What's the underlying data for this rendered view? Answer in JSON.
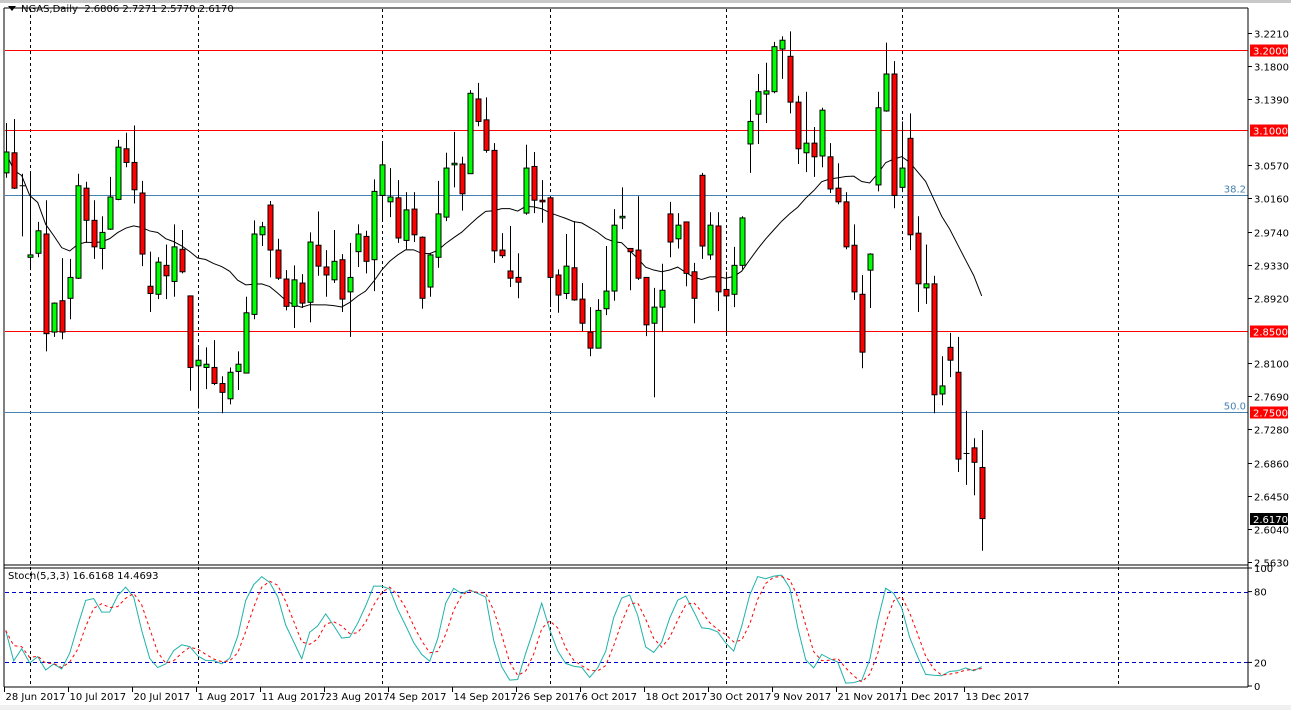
{
  "header": {
    "symbol": "NGAS,Daily",
    "ohlc": "2.6806 2.7271 2.5770 2.6170"
  },
  "stoch_label": "Stoch(5,3,3) 16.6168 14.4693",
  "colors": {
    "bull": "#00ff00",
    "bear": "#ff0000",
    "level": "#ff0000",
    "fib": "#4682b4",
    "k_line": "#20b2aa",
    "d_line": "#ff0000",
    "stoch_levels": "#0000cd"
  },
  "chart_data": {
    "type": "candlestick",
    "title": "NGAS,Daily",
    "ylim": [
      2.563,
      3.221
    ],
    "price_ticks": [
      "3.2210",
      "3.1800",
      "3.1390",
      "3.0570",
      "3.0160",
      "2.9740",
      "2.9330",
      "2.8920",
      "2.8100",
      "2.7690",
      "2.7280",
      "2.6860",
      "2.6450",
      "2.6040",
      "2.5630"
    ],
    "date_labels": [
      {
        "bar": 0,
        "label": "28 Jun 2017"
      },
      {
        "bar": 8,
        "label": "10 Jul 2017"
      },
      {
        "bar": 16,
        "label": "20 Jul 2017"
      },
      {
        "bar": 24,
        "label": "1 Aug 2017"
      },
      {
        "bar": 32,
        "label": "11 Aug 2017"
      },
      {
        "bar": 40,
        "label": "23 Aug 2017"
      },
      {
        "bar": 48,
        "label": "4 Sep 2017"
      },
      {
        "bar": 56,
        "label": "14 Sep 2017"
      },
      {
        "bar": 64,
        "label": "26 Sep 2017"
      },
      {
        "bar": 72,
        "label": "6 Oct 2017"
      },
      {
        "bar": 80,
        "label": "18 Oct 2017"
      },
      {
        "bar": 88,
        "label": "30 Oct 2017"
      },
      {
        "bar": 96,
        "label": "9 Nov 2017"
      },
      {
        "bar": 104,
        "label": "21 Nov 2017"
      },
      {
        "bar": 112,
        "label": "1 Dec 2017"
      },
      {
        "bar": 120,
        "label": "13 Dec 2017"
      }
    ],
    "period_separators": [
      3,
      24,
      47,
      68,
      90,
      112,
      139
    ],
    "horizontal_levels": [
      {
        "price": 3.2,
        "label": "3.2000"
      },
      {
        "price": 3.1,
        "label": "3.1000"
      },
      {
        "price": 2.85,
        "label": "2.8500"
      }
    ],
    "fib_levels": [
      {
        "price": 3.02,
        "ratio": "38.2"
      },
      {
        "price": 2.75,
        "ratio": "50.0",
        "label": "2.7500"
      }
    ],
    "last_price": {
      "price": 2.617,
      "label": "2.6170"
    },
    "moving_average": {
      "type": "SMA",
      "period": 20
    },
    "stochastic": {
      "k": 5,
      "d": 3,
      "slowing": 3,
      "levels": [
        80,
        20
      ],
      "ticks": [
        "100",
        "80",
        "20",
        "0"
      ]
    },
    "ohlc": [
      [
        3.047,
        3.109,
        3.041,
        3.073
      ],
      [
        3.072,
        3.114,
        3.027,
        3.028
      ],
      [
        3.031,
        3.046,
        2.968,
        3.03
      ],
      [
        2.942,
        3.048,
        2.926,
        2.945
      ],
      [
        2.947,
        2.986,
        2.942,
        2.975
      ],
      [
        2.971,
        3.013,
        2.825,
        2.847
      ],
      [
        2.849,
        2.886,
        2.843,
        2.885
      ],
      [
        2.888,
        2.941,
        2.84,
        2.849
      ],
      [
        2.891,
        2.94,
        2.865,
        2.917
      ],
      [
        2.916,
        3.046,
        2.915,
        3.031
      ],
      [
        3.028,
        3.036,
        2.96,
        2.988
      ],
      [
        2.988,
        3.013,
        2.94,
        2.955
      ],
      [
        2.953,
        2.993,
        2.927,
        2.973
      ],
      [
        2.977,
        3.042,
        2.976,
        3.017
      ],
      [
        3.014,
        3.088,
        3.013,
        3.079
      ],
      [
        3.077,
        3.097,
        3.054,
        3.06
      ],
      [
        3.06,
        3.106,
        3.009,
        3.026
      ],
      [
        3.022,
        3.037,
        2.931,
        2.946
      ],
      [
        2.906,
        2.949,
        2.874,
        2.897
      ],
      [
        2.896,
        2.942,
        2.89,
        2.936
      ],
      [
        2.932,
        2.958,
        2.89,
        2.919
      ],
      [
        2.912,
        2.983,
        2.893,
        2.955
      ],
      [
        2.952,
        2.976,
        2.922,
        2.924
      ],
      [
        2.894,
        2.894,
        2.776,
        2.805
      ],
      [
        2.807,
        2.832,
        2.754,
        2.814
      ],
      [
        2.805,
        2.83,
        2.778,
        2.809
      ],
      [
        2.805,
        2.839,
        2.783,
        2.785
      ],
      [
        2.785,
        2.794,
        2.748,
        2.774
      ],
      [
        2.766,
        2.805,
        2.759,
        2.799
      ],
      [
        2.8,
        2.825,
        2.777,
        2.809
      ],
      [
        2.798,
        2.893,
        2.798,
        2.873
      ],
      [
        2.871,
        2.988,
        2.865,
        2.971
      ],
      [
        2.97,
        2.986,
        2.956,
        2.98
      ],
      [
        3.007,
        3.012,
        2.917,
        2.951
      ],
      [
        2.951,
        2.965,
        2.914,
        2.916
      ],
      [
        2.915,
        2.926,
        2.876,
        2.881
      ],
      [
        2.881,
        2.932,
        2.854,
        2.914
      ],
      [
        2.91,
        2.921,
        2.879,
        2.885
      ],
      [
        2.886,
        2.973,
        2.861,
        2.961
      ],
      [
        2.957,
        2.999,
        2.919,
        2.931
      ],
      [
        2.93,
        2.951,
        2.893,
        2.92
      ],
      [
        2.914,
        2.976,
        2.91,
        2.937
      ],
      [
        2.939,
        2.946,
        2.874,
        2.89
      ],
      [
        2.899,
        2.96,
        2.843,
        2.917
      ],
      [
        2.949,
        2.983,
        2.93,
        2.971
      ],
      [
        2.968,
        2.975,
        2.922,
        2.937
      ],
      [
        2.939,
        3.039,
        2.9,
        3.024
      ],
      [
        3.019,
        3.085,
        2.988,
        3.057
      ],
      [
        3.011,
        3.053,
        2.992,
        3.017
      ],
      [
        3.016,
        3.038,
        2.96,
        2.966
      ],
      [
        2.963,
        3.023,
        2.952,
        3.001
      ],
      [
        3.002,
        3.023,
        2.961,
        2.97
      ],
      [
        2.967,
        2.968,
        2.878,
        2.891
      ],
      [
        2.905,
        2.947,
        2.893,
        2.945
      ],
      [
        2.942,
        3.037,
        2.929,
        2.996
      ],
      [
        2.992,
        3.072,
        2.987,
        3.053
      ],
      [
        3.057,
        3.098,
        3.029,
        3.059
      ],
      [
        3.058,
        3.067,
        3.0,
        3.021
      ],
      [
        3.046,
        3.15,
        3.046,
        3.146
      ],
      [
        3.139,
        3.159,
        3.105,
        3.111
      ],
      [
        3.113,
        3.141,
        3.072,
        3.075
      ],
      [
        3.075,
        3.084,
        2.935,
        2.95
      ],
      [
        2.951,
        2.972,
        2.941,
        2.944
      ],
      [
        2.925,
        2.981,
        2.905,
        2.916
      ],
      [
        2.917,
        2.947,
        2.891,
        2.911
      ],
      [
        2.997,
        3.082,
        2.995,
        3.053
      ],
      [
        3.055,
        3.073,
        2.997,
        3.013
      ],
      [
        3.013,
        3.038,
        2.985,
        3.011
      ],
      [
        3.016,
        3.016,
        2.88,
        2.917
      ],
      [
        2.92,
        2.927,
        2.873,
        2.895
      ],
      [
        2.897,
        2.971,
        2.89,
        2.931
      ],
      [
        2.929,
        2.987,
        2.888,
        2.889
      ],
      [
        2.89,
        2.91,
        2.85,
        2.86
      ],
      [
        2.849,
        2.88,
        2.819,
        2.829
      ],
      [
        2.829,
        2.89,
        2.829,
        2.876
      ],
      [
        2.878,
        2.956,
        2.87,
        2.9
      ],
      [
        2.9,
        3.002,
        2.888,
        2.982
      ],
      [
        2.991,
        3.029,
        2.977,
        2.993
      ],
      [
        2.953,
        2.953,
        2.901,
        2.949
      ],
      [
        2.951,
        3.018,
        2.914,
        2.916
      ],
      [
        2.917,
        2.917,
        2.844,
        2.858
      ],
      [
        2.86,
        2.904,
        2.768,
        2.88
      ],
      [
        2.88,
        2.934,
        2.849,
        2.901
      ],
      [
        2.996,
        3.011,
        2.942,
        2.961
      ],
      [
        2.965,
        2.997,
        2.953,
        2.982
      ],
      [
        2.986,
        2.986,
        2.906,
        2.922
      ],
      [
        2.924,
        2.935,
        2.86,
        2.891
      ],
      [
        3.044,
        3.047,
        2.94,
        2.956
      ],
      [
        2.945,
        2.998,
        2.939,
        2.982
      ],
      [
        2.981,
        2.998,
        2.875,
        2.899
      ],
      [
        2.902,
        2.924,
        2.845,
        2.894
      ],
      [
        2.896,
        2.955,
        2.88,
        2.932
      ],
      [
        2.932,
        2.993,
        2.927,
        2.991
      ],
      [
        3.083,
        3.138,
        3.047,
        3.111
      ],
      [
        3.12,
        3.17,
        3.083,
        3.148
      ],
      [
        3.145,
        3.184,
        3.109,
        3.149
      ],
      [
        3.148,
        3.21,
        3.146,
        3.204
      ],
      [
        3.201,
        3.217,
        3.164,
        3.212
      ],
      [
        3.192,
        3.223,
        3.121,
        3.135
      ],
      [
        3.135,
        3.143,
        3.058,
        3.077
      ],
      [
        3.072,
        3.148,
        3.048,
        3.084
      ],
      [
        3.084,
        3.104,
        3.042,
        3.067
      ],
      [
        3.068,
        3.128,
        3.054,
        3.125
      ],
      [
        3.067,
        3.084,
        3.022,
        3.027
      ],
      [
        3.028,
        3.059,
        3.008,
        3.011
      ],
      [
        3.011,
        3.023,
        2.952,
        2.955
      ],
      [
        2.957,
        2.983,
        2.889,
        2.899
      ],
      [
        2.896,
        2.92,
        2.804,
        2.824
      ],
      [
        2.926,
        2.947,
        2.879,
        2.946
      ],
      [
        3.032,
        3.148,
        3.024,
        3.128
      ],
      [
        3.124,
        3.209,
        3.123,
        3.17
      ],
      [
        3.17,
        3.186,
        3.003,
        3.019
      ],
      [
        3.029,
        3.111,
        3.023,
        3.053
      ],
      [
        3.09,
        3.121,
        2.951,
        2.97
      ],
      [
        2.972,
        2.993,
        2.874,
        2.909
      ],
      [
        2.904,
        2.958,
        2.884,
        2.909
      ],
      [
        2.909,
        2.919,
        2.748,
        2.771
      ],
      [
        2.772,
        2.819,
        2.758,
        2.782
      ],
      [
        2.83,
        2.848,
        2.793,
        2.814
      ],
      [
        2.799,
        2.843,
        2.675,
        2.691
      ],
      [
        2.698,
        2.751,
        2.659,
        2.698
      ],
      [
        2.705,
        2.717,
        2.646,
        2.687
      ],
      [
        2.6806,
        2.7271,
        2.577,
        2.617
      ]
    ]
  }
}
